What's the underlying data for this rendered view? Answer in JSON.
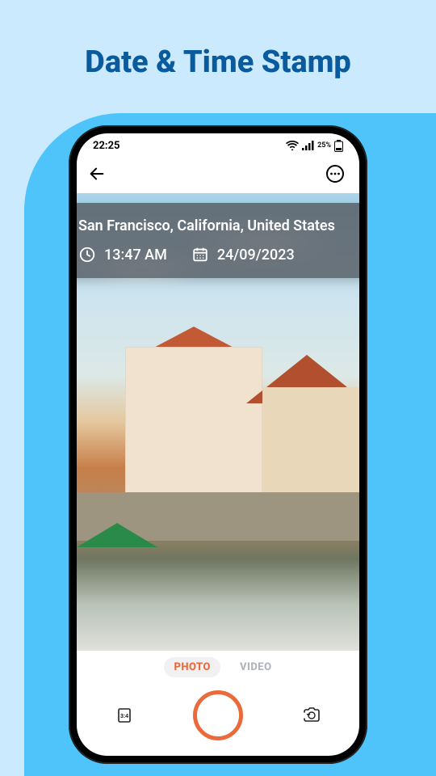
{
  "page_title": "Date & Time Stamp",
  "statusbar": {
    "time": "22:25",
    "battery_pct": "25%"
  },
  "stamp": {
    "location": "San Francisco, California, United States",
    "time": "13:47 AM",
    "date": "24/09/2023"
  },
  "modes": {
    "photo": "PHOTO",
    "video": "VIDEO"
  },
  "aspect_label": "3:4"
}
